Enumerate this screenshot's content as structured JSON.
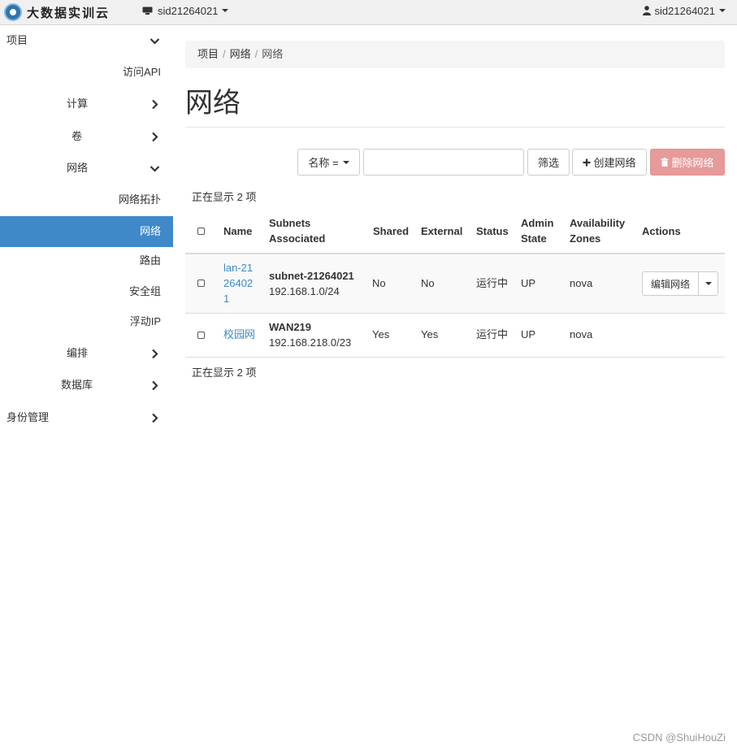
{
  "app": {
    "brand_name": "大数据实训云",
    "project_selector": "sid21264021",
    "user_menu": "sid21264021"
  },
  "sidebar": {
    "items": [
      {
        "label": "项目",
        "chevron": "down"
      },
      {
        "label": "访问API"
      },
      {
        "label": "计算",
        "chevron": "right"
      },
      {
        "label": "卷",
        "chevron": "right"
      },
      {
        "label": "网络",
        "chevron": "down"
      },
      {
        "label": "网络拓扑"
      },
      {
        "label": "网络",
        "active": true
      },
      {
        "label": "路由"
      },
      {
        "label": "安全组"
      },
      {
        "label": "浮动IP"
      },
      {
        "label": "编排",
        "chevron": "right"
      },
      {
        "label": "数据库",
        "chevron": "right"
      },
      {
        "label": "身份管理",
        "chevron": "right"
      }
    ],
    "active_color": "#3f89c9"
  },
  "breadcrumb": [
    "项目",
    "网络",
    "网络"
  ],
  "page": {
    "title": "网络"
  },
  "toolbar": {
    "filter_field": "名称 =",
    "filter_value": "",
    "filter_button": "筛选",
    "create_button": "创建网络",
    "delete_button": "删除网络"
  },
  "count_text_top": "正在显示 2 项",
  "count_text_bottom": "正在显示 2 项",
  "table": {
    "headers": {
      "name": "Name",
      "subnets_line1": "Subnets",
      "subnets_line2": "Associated",
      "shared": "Shared",
      "external": "External",
      "status": "Status",
      "admin_line1": "Admin",
      "admin_line2": "State",
      "az_line1": "Availability",
      "az_line2": "Zones",
      "actions": "Actions"
    },
    "rows": [
      {
        "name": "lan-21264021",
        "subnet_name": "subnet-21264021",
        "subnet_cidr": "192.168.1.0/24",
        "shared": "No",
        "external": "No",
        "status": "运行中",
        "admin_state": "UP",
        "zones": "nova",
        "action": "编辑网络"
      },
      {
        "name": "校园网",
        "subnet_name": "WAN219",
        "subnet_cidr": "192.168.218.0/23",
        "shared": "Yes",
        "external": "Yes",
        "status": "运行中",
        "admin_state": "UP",
        "zones": "nova",
        "action": ""
      }
    ]
  },
  "watermark": "CSDN @ShuiHouZi",
  "colors": {
    "link": "#3f89c9",
    "danger": "#e69a99"
  }
}
